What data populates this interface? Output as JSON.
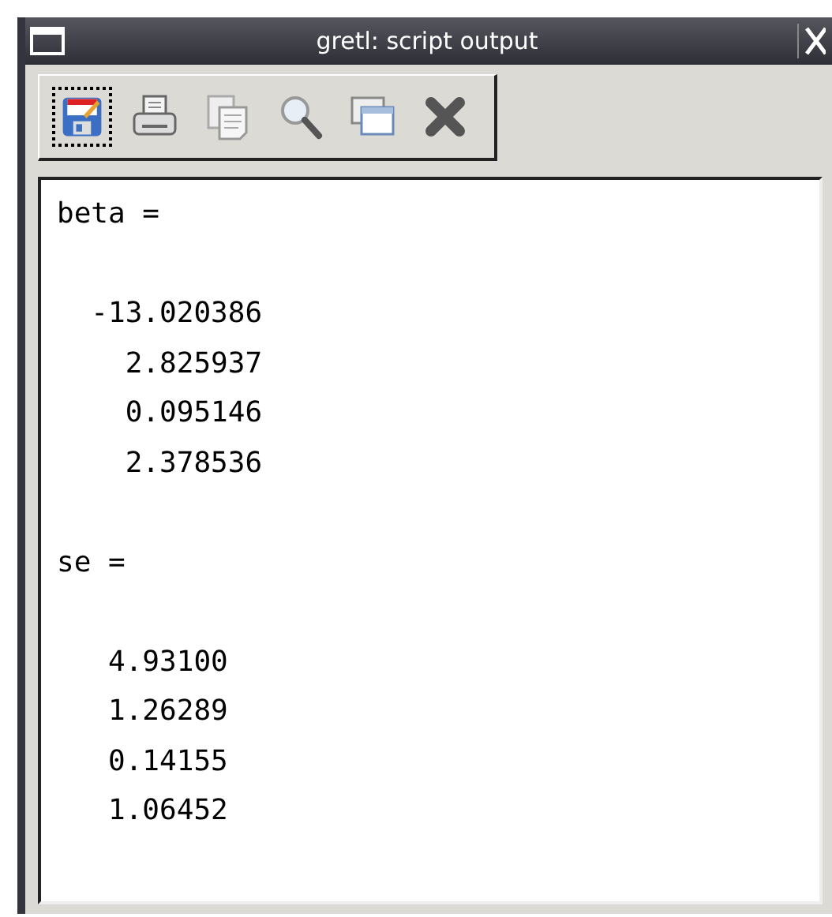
{
  "window": {
    "title": "gretl: script output"
  },
  "toolbar": {
    "buttons": [
      {
        "kind": "save",
        "focused": true
      },
      {
        "kind": "print",
        "focused": false
      },
      {
        "kind": "copy",
        "focused": false
      },
      {
        "kind": "find",
        "focused": false
      },
      {
        "kind": "windows",
        "focused": false
      },
      {
        "kind": "close",
        "focused": false
      }
    ]
  },
  "output": {
    "blocks": [
      {
        "header": "beta =",
        "values": [
          "  -13.020386",
          "    2.825937",
          "    0.095146",
          "    2.378536"
        ]
      },
      {
        "header": "se =",
        "values": [
          "   4.93100",
          "   1.26289",
          "   0.14155",
          "   1.06452"
        ]
      }
    ]
  }
}
